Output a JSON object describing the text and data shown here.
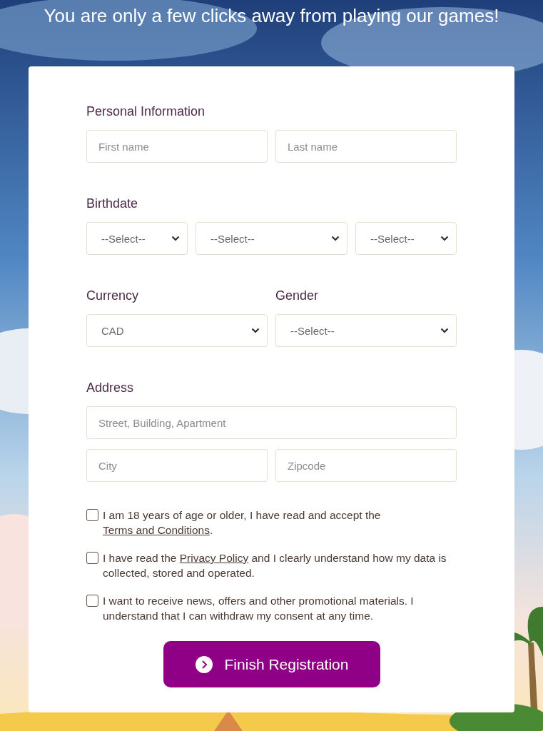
{
  "headline": "You are only a few clicks away from playing our games!",
  "sections": [
    {
      "kind": "pair",
      "label": "Personal Information",
      "fields": [
        {
          "kind": "input",
          "placeholder": "First name"
        },
        {
          "kind": "input",
          "placeholder": "Last name"
        }
      ]
    },
    {
      "kind": "triple",
      "label": "Birthdate",
      "fields": [
        {
          "kind": "select",
          "value": "--Select--"
        },
        {
          "kind": "select",
          "value": "--Select--"
        },
        {
          "kind": "select",
          "value": "--Select--"
        }
      ]
    },
    {
      "kind": "split",
      "columns": [
        {
          "label": "Currency",
          "field": {
            "kind": "select",
            "value": "CAD"
          }
        },
        {
          "label": "Gender",
          "field": {
            "kind": "select",
            "value": "--Select--"
          }
        }
      ]
    },
    {
      "kind": "address",
      "label": "Address",
      "fields": [
        {
          "kind": "input",
          "placeholder": "Street, Building, Apartment"
        }
      ],
      "fields_row": [
        {
          "kind": "input",
          "placeholder": "City"
        },
        {
          "kind": "input",
          "placeholder": "Zipcode"
        }
      ]
    }
  ],
  "consents": [
    {
      "checked": false,
      "text_before": "I am 18 years of age or older, I have read and accept the ",
      "link": "Terms and Conditions",
      "text_after": "."
    },
    {
      "checked": false,
      "text_before": "I have read the ",
      "link": "Privacy Policy",
      "text_after": " and I clearly understand how my data is collected, stored and operated."
    },
    {
      "checked": false,
      "text_before": "I want to receive news, offers and other promotional materials. I understand that I can withdraw my consent at any time."
    }
  ],
  "submit": {
    "label": "Finish Registration"
  }
}
